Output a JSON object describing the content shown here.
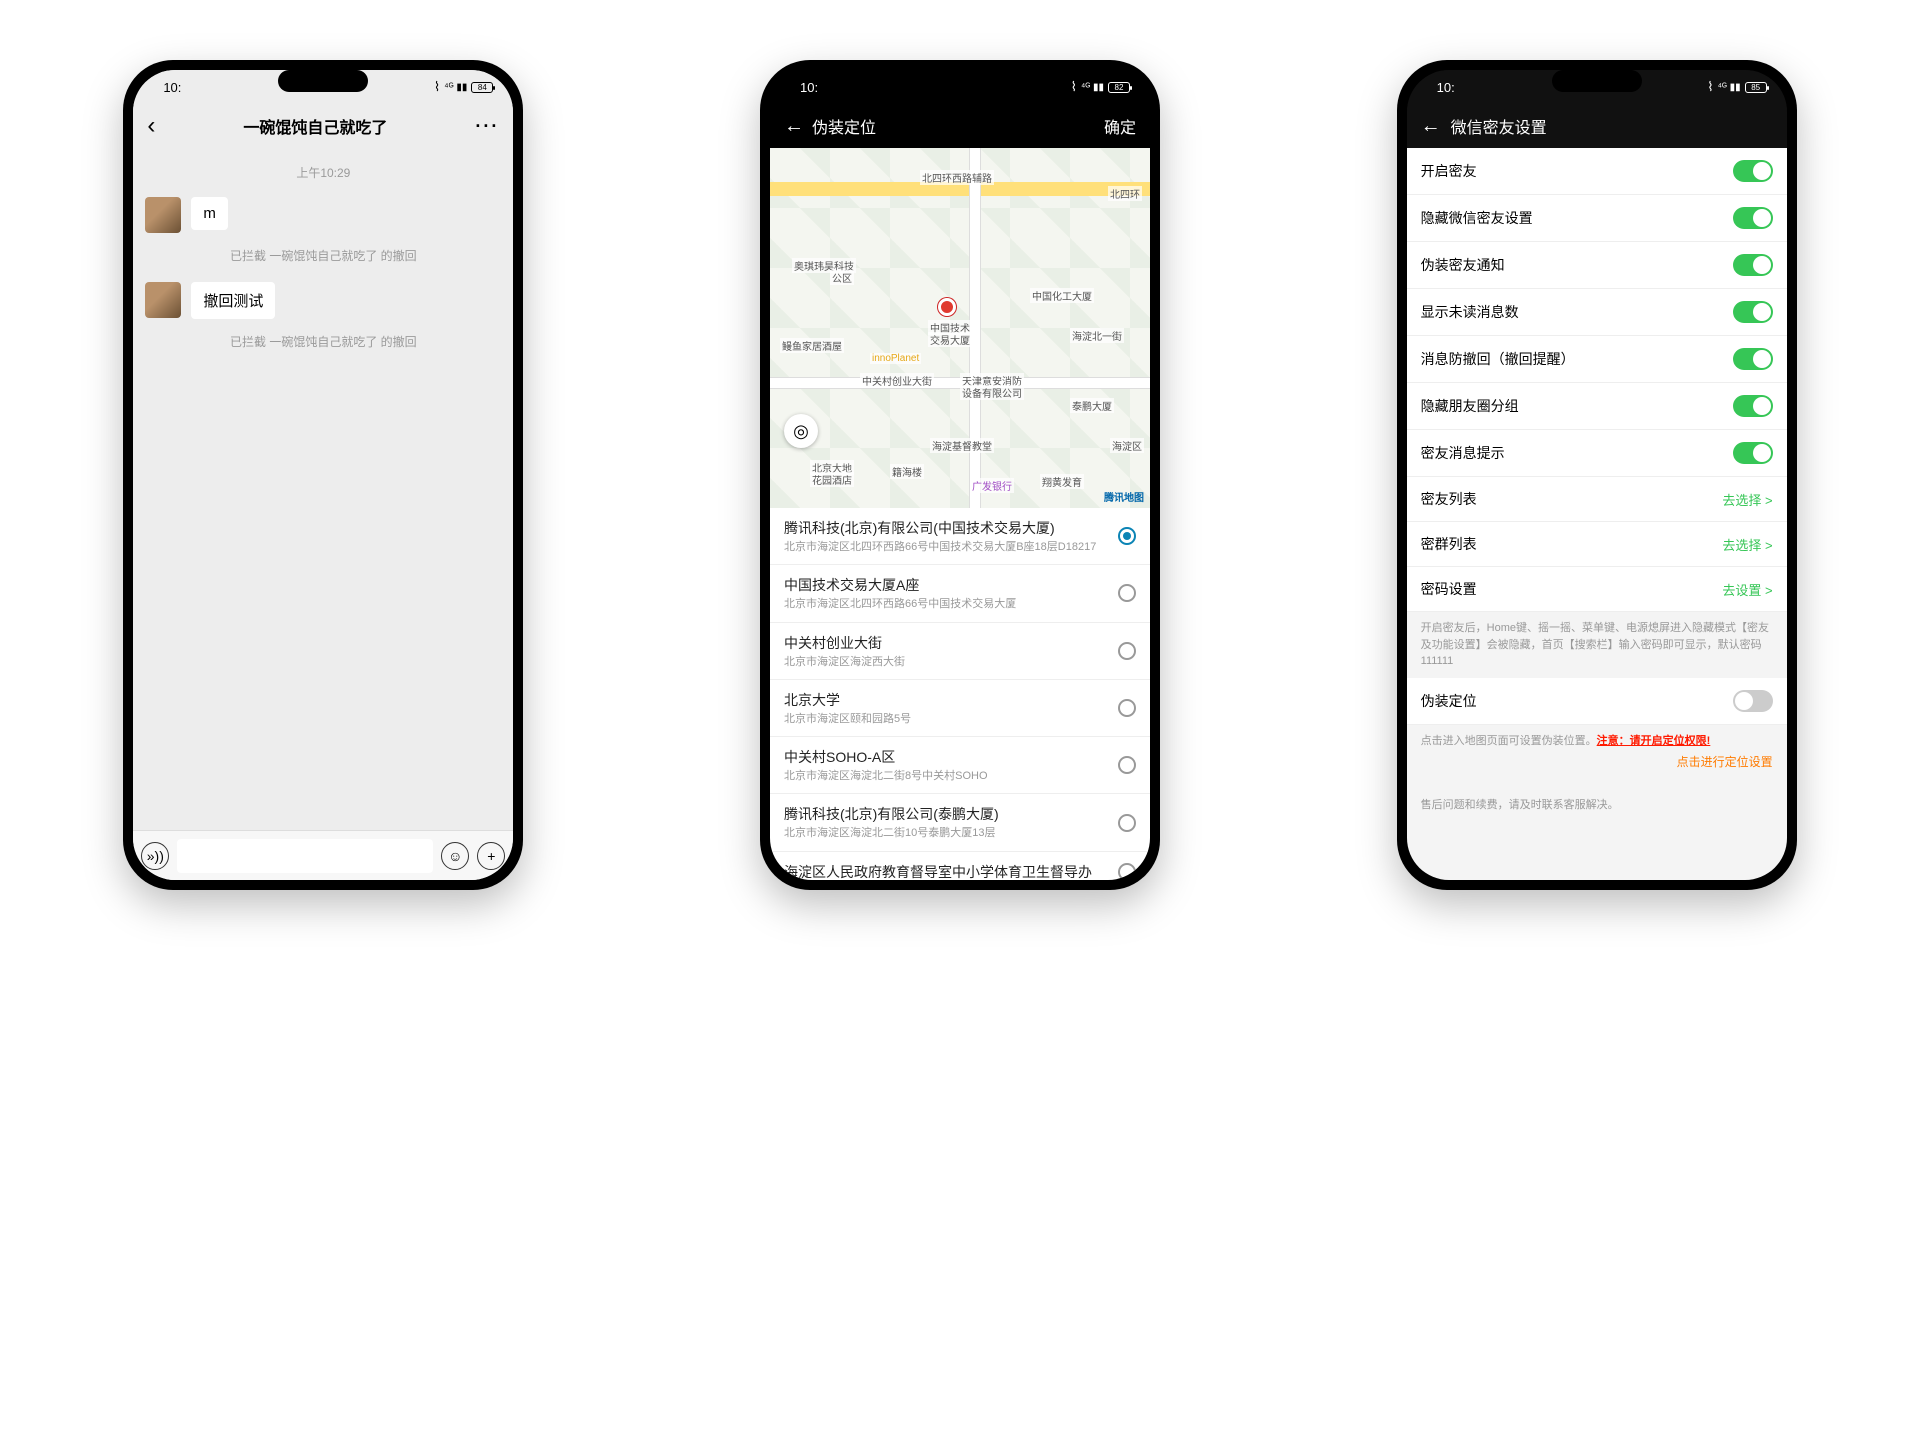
{
  "phone1": {
    "status_time": "10:",
    "battery": "84",
    "header_title": "一碗馄饨自己就吃了",
    "timestamp": "上午10:29",
    "msg1": "m",
    "sys1": "已拦截 一碗馄饨自己就吃了 的撤回",
    "msg2": "撤回测试",
    "sys2": "已拦截 一碗馄饨自己就吃了 的撤回"
  },
  "phone2": {
    "status_time": "10:",
    "battery": "82",
    "header_title": "伪装定位",
    "confirm": "确定",
    "map_labels": {
      "road_top": "北四环西路辅路",
      "road_top2": "北四环",
      "l1": "奥琪玮昊科技",
      "l1b": "公区",
      "l2": "鳗鱼家居酒屋",
      "l3": "innoPlanet",
      "l4": "中国技术",
      "l4b": "交易大厦",
      "l5": "中国化工大厦",
      "l5b": "海淀北一街",
      "l6": "中关村创业大街",
      "l7": "天津意安消防",
      "l7b": "设备有限公司",
      "l8": "泰鹏大厦",
      "l9": "海淀基督教堂",
      "l10": "北京大地",
      "l10b": "花园酒店",
      "l11": "籍海楼",
      "l12": "广发银行",
      "l13": "翔黄发育",
      "l14": "海淀区",
      "attr": "腾讯地图"
    },
    "locations": [
      {
        "name": "腾讯科技(北京)有限公司(中国技术交易大厦)",
        "addr": "北京市海淀区北四环西路66号中国技术交易大厦B座18层D18217",
        "selected": true
      },
      {
        "name": "中国技术交易大厦A座",
        "addr": "北京市海淀区北四环西路66号中国技术交易大厦",
        "selected": false
      },
      {
        "name": "中关村创业大街",
        "addr": "北京市海淀区海淀西大街",
        "selected": false
      },
      {
        "name": "北京大学",
        "addr": "北京市海淀区颐和园路5号",
        "selected": false
      },
      {
        "name": "中关村SOHO-A区",
        "addr": "北京市海淀区海淀北二街8号中关村SOHO",
        "selected": false
      },
      {
        "name": "腾讯科技(北京)有限公司(泰鹏大厦)",
        "addr": "北京市海淀区海淀北二街10号泰鹏大厦13层",
        "selected": false
      },
      {
        "name": "海淀区人民政府教育督导室中小学体育卫生督导办",
        "addr": "",
        "selected": false
      }
    ]
  },
  "phone3": {
    "status_time": "10:",
    "battery": "85",
    "header_title": "微信密友设置",
    "toggles": [
      {
        "label": "开启密友",
        "on": true
      },
      {
        "label": "隐藏微信密友设置",
        "on": true
      },
      {
        "label": "伪装密友通知",
        "on": true
      },
      {
        "label": "显示未读消息数",
        "on": true
      },
      {
        "label": "消息防撤回（撤回提醒）",
        "on": true
      },
      {
        "label": "隐藏朋友圈分组",
        "on": true
      },
      {
        "label": "密友消息提示",
        "on": true
      }
    ],
    "links": [
      {
        "label": "密友列表",
        "action": "去选择 >"
      },
      {
        "label": "密群列表",
        "action": "去选择 >"
      },
      {
        "label": "密码设置",
        "action": "去设置 >"
      }
    ],
    "hint1": "开启密友后，Home键、摇一摇、菜单键、电源熄屏进入隐藏模式【密友及功能设置】会被隐藏，首页【搜索栏】输入密码即可显示，默认密码111111",
    "fakeloc_label": "伪装定位",
    "hint2_a": "点击进入地图页面可设置伪装位置。",
    "hint2_b": "注意：请开启定位权限!",
    "hint2_c": "点击进行定位设置",
    "hint3": "售后问题和续费，请及时联系客服解决。"
  }
}
